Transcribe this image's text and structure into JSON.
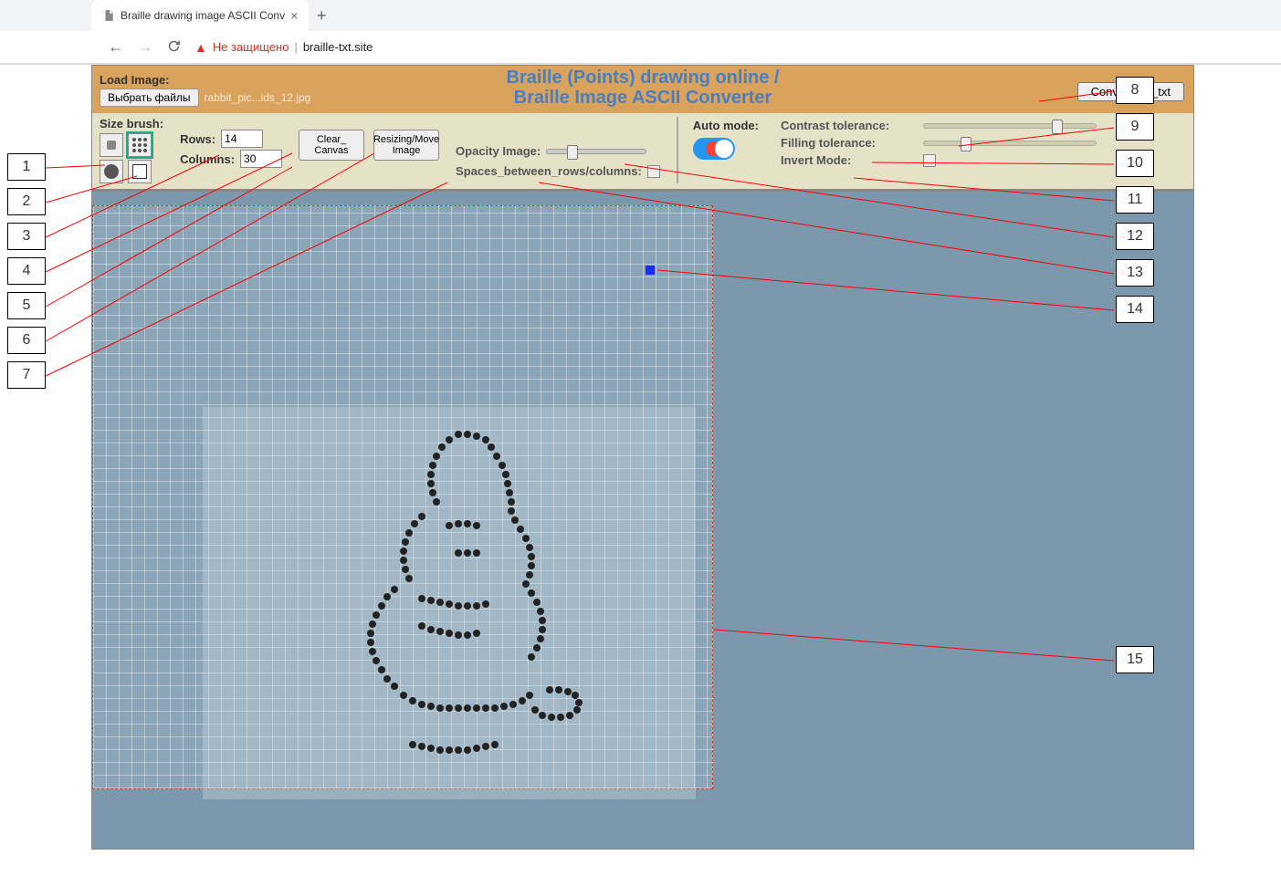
{
  "browser": {
    "tab_title": "Braille drawing image ASCII Conv",
    "not_secure_text": "Не защищено",
    "url": "braille-txt.site"
  },
  "header": {
    "load_image_label": "Load Image:",
    "choose_file_btn": "Выбрать файлы",
    "filename": "rabbit_pic...ids_12.jpg",
    "title_line1": "Braille (Points) drawing online /",
    "title_line2": "Braille Image ASCII Converter",
    "convert_btn": "Convert_To_txt"
  },
  "left_controls": {
    "size_brush_label": "Size brush:",
    "rows_label": "Rows:",
    "rows_value": "14",
    "columns_label": "Columns:",
    "columns_value": "30",
    "clear_btn": "Clear_\nCanvas",
    "resize_btn": "Resizing/Move\nImage",
    "opacity_label": "Opacity Image:",
    "spaces_label": "Spaces_between_rows/columns:"
  },
  "right_controls": {
    "auto_mode_label": "Auto mode:",
    "contrast_label": "Contrast tolerance:",
    "filling_label": "Filling tolerance:",
    "invert_label": "Invert Mode:"
  },
  "annotations": [
    "1",
    "2",
    "3",
    "4",
    "5",
    "6",
    "7",
    "8",
    "9",
    "10",
    "11",
    "12",
    "13",
    "14",
    "15"
  ]
}
